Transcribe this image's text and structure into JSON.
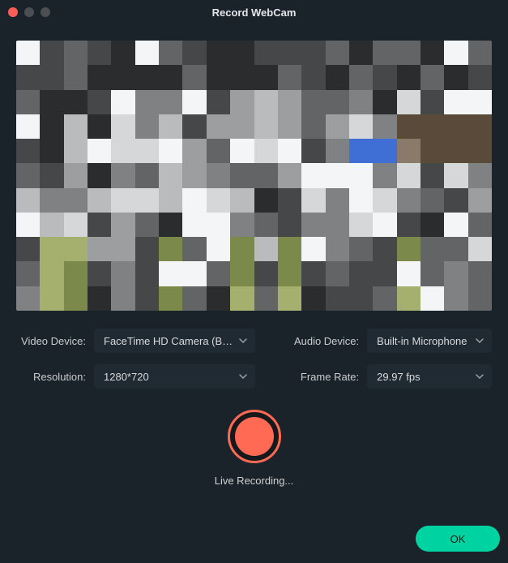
{
  "window": {
    "title": "Record WebCam"
  },
  "labels": {
    "video_device": "Video Device:",
    "audio_device": "Audio Device:",
    "resolution": "Resolution:",
    "frame_rate": "Frame Rate:"
  },
  "values": {
    "video_device": "FaceTime HD Camera (B…",
    "audio_device": "Built-in Microphone",
    "resolution": "1280*720",
    "frame_rate": "29.97 fps"
  },
  "record": {
    "status": "Live Recording..."
  },
  "buttons": {
    "ok": "OK"
  },
  "preview": {
    "pixelated": true,
    "rows": 11,
    "cols": 20,
    "palette": [
      "#f4f5f6",
      "#d6d7d8",
      "#b9bbbd",
      "#9c9ea0",
      "#7f8183",
      "#626466",
      "#454749",
      "#2a2c2e",
      "#1a1c1e",
      "#3f6fd4",
      "#7b8a4a",
      "#a6b06e",
      "#5a4a3a",
      "#8a7a6a"
    ]
  }
}
